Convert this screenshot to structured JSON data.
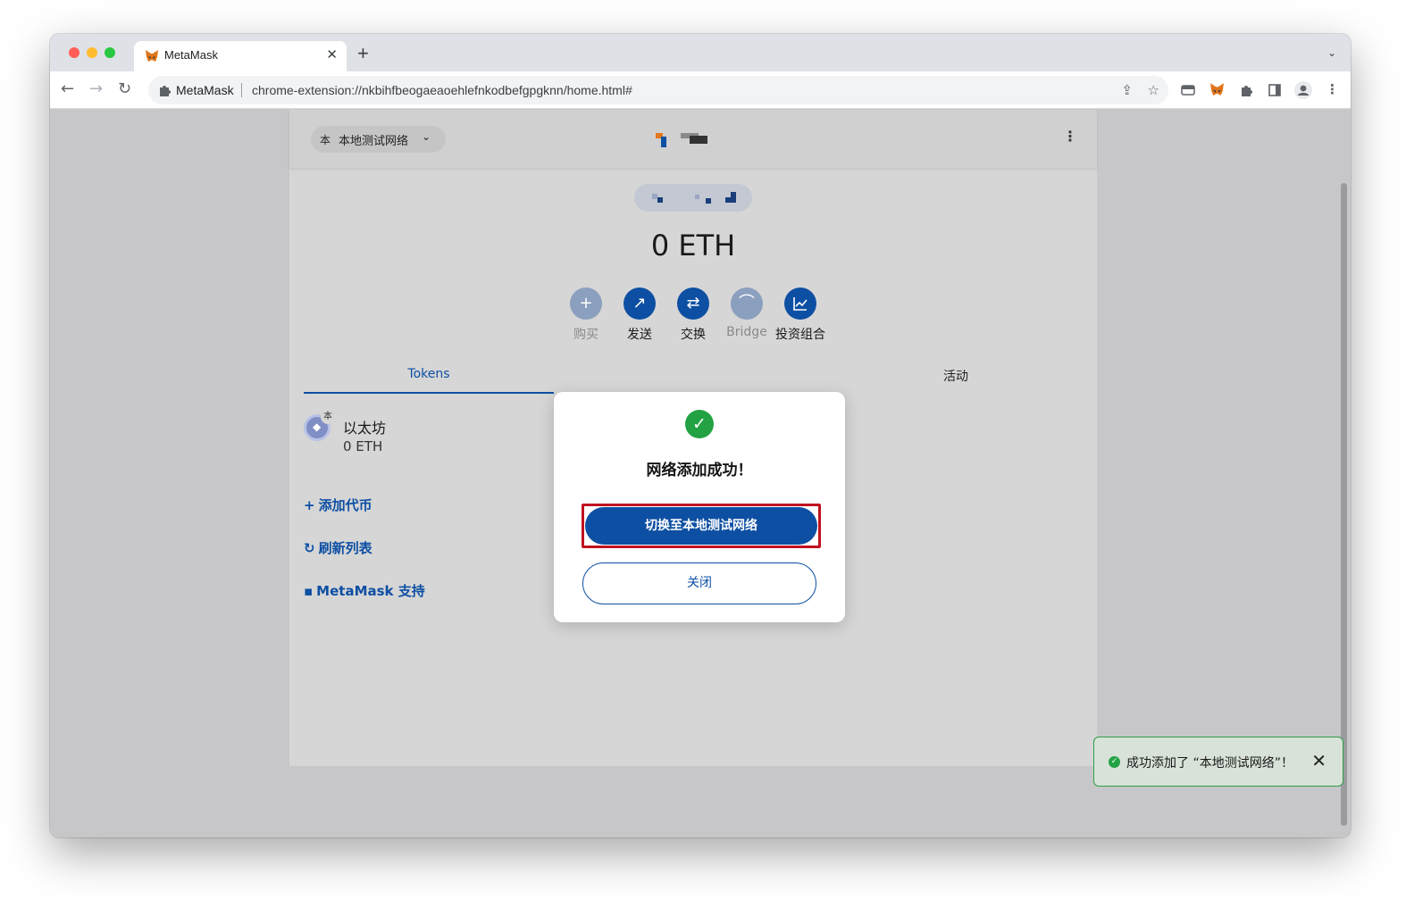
{
  "browser": {
    "tab_title": "MetaMask",
    "tab_close": "✕",
    "new_tab": "+",
    "tab_list": "⌄",
    "site_name": "MetaMask",
    "url": "chrome-extension://nkbihfbeogaeaoehlefnkodbefgpgknn/home.html#"
  },
  "metamask": {
    "network": {
      "badge": "本",
      "name": "本地测试网络",
      "chevron": "⌄"
    },
    "menu_glyph": "⋮",
    "balance": "0 ETH",
    "actions": [
      {
        "label": "购买",
        "icon": "plus-icon",
        "glyph": "+",
        "enabled": false
      },
      {
        "label": "发送",
        "icon": "arrow-up-right-icon",
        "glyph": "↗",
        "enabled": true
      },
      {
        "label": "交换",
        "icon": "swap-icon",
        "glyph": "⇄",
        "enabled": true
      },
      {
        "label": "Bridge",
        "icon": "bridge-icon",
        "glyph": "⌒",
        "enabled": false
      },
      {
        "label": "投资组合",
        "icon": "chart-icon",
        "glyph": "📈",
        "enabled": true
      }
    ],
    "tabs": {
      "tokens": "Tokens",
      "activity": "活动"
    },
    "token": {
      "badge": "本",
      "name": "以太坊",
      "balance": "0 ETH"
    },
    "links": {
      "add_token": "添加代币",
      "refresh": "刷新列表",
      "support": "MetaMask 支持"
    }
  },
  "modal": {
    "title": "网络添加成功！",
    "primary": "切换至本地测试网络",
    "secondary": "关闭"
  },
  "toast": {
    "text": "成功添加了 “本地测试网络”！",
    "close": "✕"
  },
  "colors": {
    "brand_blue": "#0d4fa3",
    "success_green": "#23a244",
    "highlight_red": "#c1121f"
  }
}
